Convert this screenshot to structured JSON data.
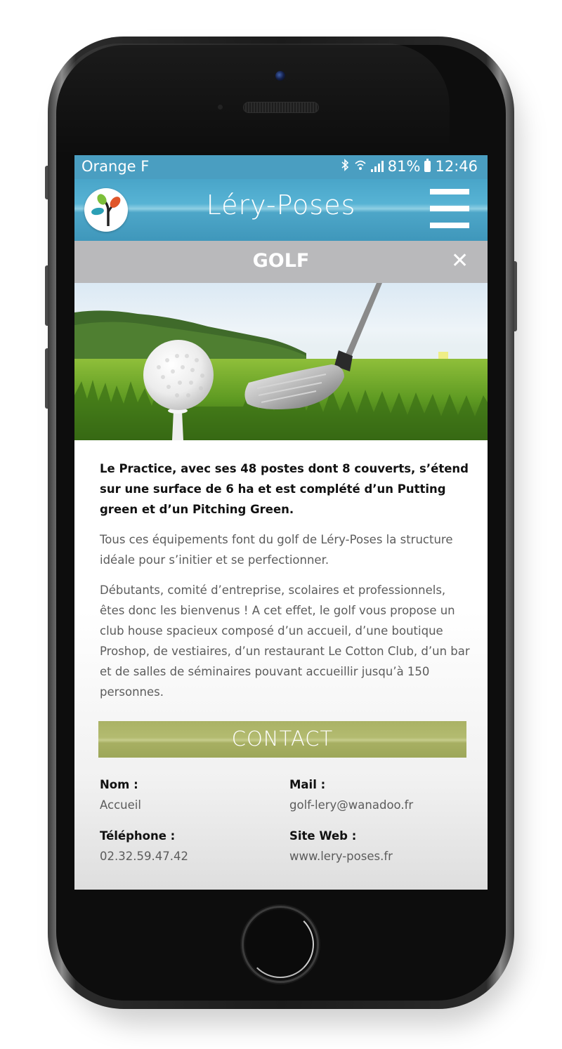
{
  "status_bar": {
    "carrier": "Orange F",
    "battery": "81%",
    "time": "12:46",
    "icons": [
      "bluetooth-icon",
      "wifi-icon",
      "signal-icon",
      "battery-icon"
    ]
  },
  "app_bar": {
    "title": "Léry-Poses",
    "logo": "tree-logo-icon",
    "menu": "hamburger-menu-icon"
  },
  "section": {
    "title": "GOLF",
    "close_icon": "close-icon"
  },
  "article": {
    "lead": "Le Practice, avec ses 48 postes dont 8 couverts, s’étend sur une surface de 6 ha et est complété d’un Putting green et d’un Pitching Green.",
    "paragraph_1": "Tous ces équipements font du golf de Léry-Poses la structure idéale pour s’initier et se perfectionner.",
    "paragraph_2": "Débutants, comité d’entreprise, scolaires et professionnels, êtes donc les bienvenus ! A cet effet, le golf vous propose un club house spacieux composé d’un accueil, d’une boutique Proshop, de vestiaires, d’un restaurant Le Cotton Club, d’un bar et de salles de séminaires pouvant accueillir jusqu’à 150 personnes."
  },
  "contact": {
    "heading": "CONTACT",
    "name_label": "Nom :",
    "name_value": "Accueil",
    "mail_label": "Mail :",
    "mail_value": "golf-lery@wanadoo.fr",
    "phone_label": "Téléphone :",
    "phone_value": "02.32.59.47.42",
    "web_label": "Site Web :",
    "web_value": "www.lery-poses.fr"
  },
  "colors": {
    "header_blue": "#4a9ec1",
    "section_grey": "#b9b9bb",
    "contact_green": "#aab265"
  }
}
